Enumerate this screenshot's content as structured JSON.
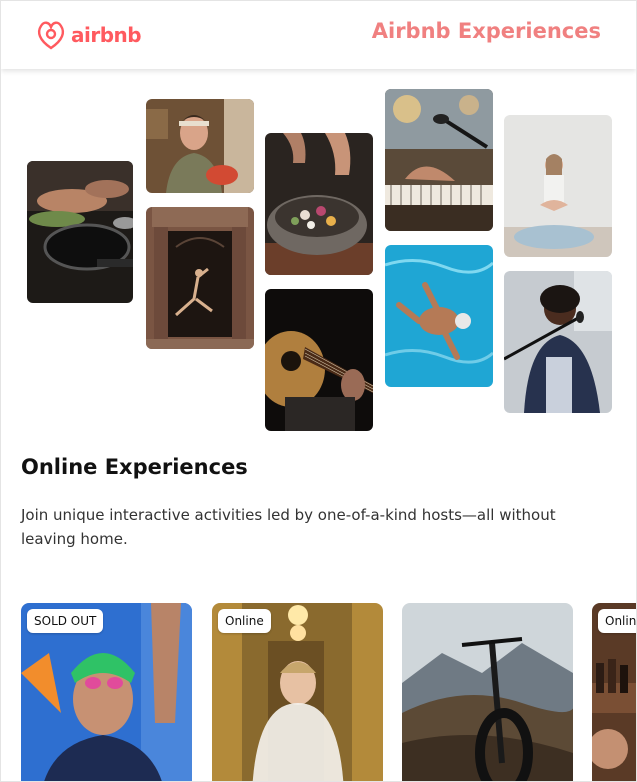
{
  "header": {
    "logo_text": "airbnb",
    "title": "Airbnb Experiences",
    "brand_color": "#ff5a5f",
    "title_color": "#f08080"
  },
  "gallery": {
    "images": [
      {
        "name": "cooking-pan-photo",
        "subject": "hands cooking in a pan"
      },
      {
        "name": "woman-kitchen-photo",
        "subject": "smiling woman in kitchen"
      },
      {
        "name": "dancer-doorway-photo",
        "subject": "dancer in an ornate doorway"
      },
      {
        "name": "food-bowl-photo",
        "subject": "hands seasoning a bowl of food"
      },
      {
        "name": "guitar-photo",
        "subject": "person playing acoustic guitar"
      },
      {
        "name": "piano-microphone-photo",
        "subject": "hands on keyboard with microphone"
      },
      {
        "name": "swimmer-photo",
        "subject": "swimmer in a pool"
      },
      {
        "name": "yoga-photo",
        "subject": "woman meditating"
      },
      {
        "name": "singer-photo",
        "subject": "singer at a microphone"
      }
    ]
  },
  "section": {
    "title": "Online Experiences",
    "description": "Join unique interactive activities led by one-of-a-kind hosts—all without leaving home."
  },
  "cards": [
    {
      "badge": "SOLD OUT",
      "subject": "swimmer with goggles"
    },
    {
      "badge": "Online",
      "subject": "bride in wedding dress"
    },
    {
      "badge": "",
      "subject": "mountain bike"
    },
    {
      "badge": "Online",
      "subject": "wine bottles"
    }
  ]
}
